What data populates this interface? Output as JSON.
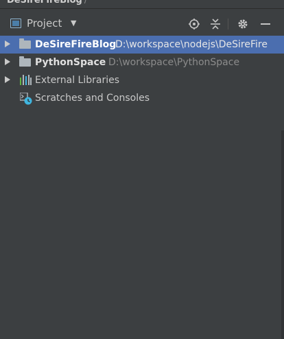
{
  "breadcrumb": {
    "project": "DeSireFireBlog",
    "separator": "/"
  },
  "toolbar": {
    "view_label": "Project",
    "dropdown_icon": "caret-down-icon",
    "buttons": [
      "locate-icon",
      "collapse-all-icon",
      "gear-icon",
      "minimize-icon"
    ]
  },
  "tree": {
    "items": [
      {
        "name": "DeSireFireBlog",
        "path": "D:\\workspace\\nodejs\\DeSireFire",
        "icon": "folder-icon",
        "selected": true
      },
      {
        "name": "PythonSpace",
        "path": "D:\\workspace\\PythonSpace",
        "icon": "folder-icon",
        "selected": false
      },
      {
        "name": "External Libraries",
        "icon": "library-icon"
      },
      {
        "name": "Scratches and Consoles",
        "icon": "scratches-icon"
      }
    ]
  },
  "colors": {
    "panel_bg": "#3c3f41",
    "selection": "#4b6eaf",
    "text": "#bbbbbb",
    "path_text": "#8c8c8c"
  }
}
